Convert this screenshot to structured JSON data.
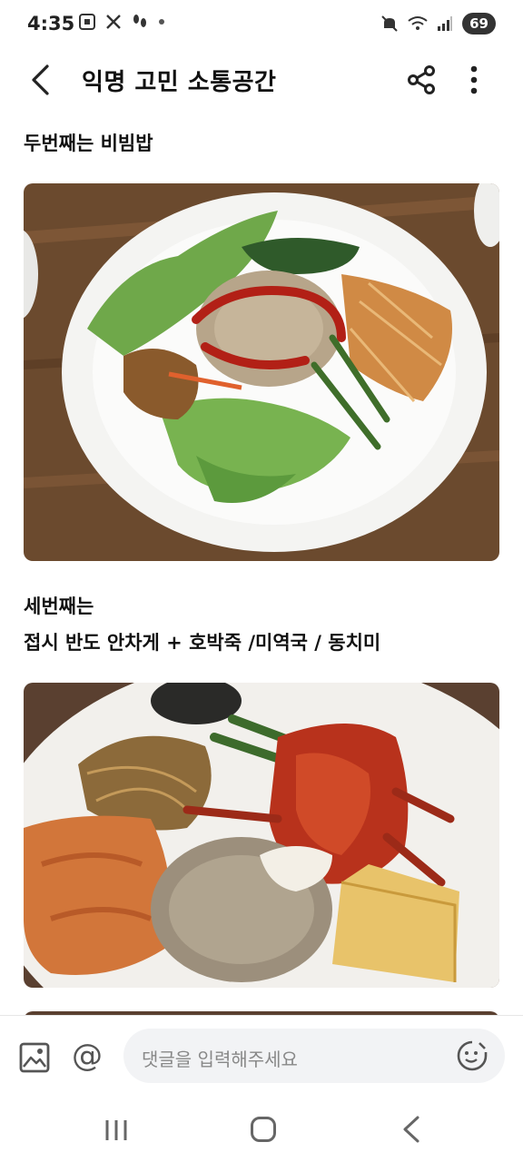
{
  "status_bar": {
    "time": "4:35",
    "battery": "69"
  },
  "header": {
    "title": "익명 고민 소통공간"
  },
  "post": {
    "caption_1": "두번째는 비빔밥",
    "caption_2_line1": "세번째는",
    "caption_2_line2": "접시 반도 안차게 + 호박죽 /미역국 / 동치미"
  },
  "comment_bar": {
    "placeholder": "댓글을 입력해주세요"
  },
  "colors": {
    "accent_text": "#111111",
    "input_bg": "#f2f3f5",
    "table_wood": "#6b4a2e"
  },
  "icons": {
    "back": "back-arrow-icon",
    "share": "share-icon",
    "more": "more-vertical-icon",
    "image": "image-icon",
    "mention": "at-icon",
    "emoji": "emoji-icon"
  }
}
